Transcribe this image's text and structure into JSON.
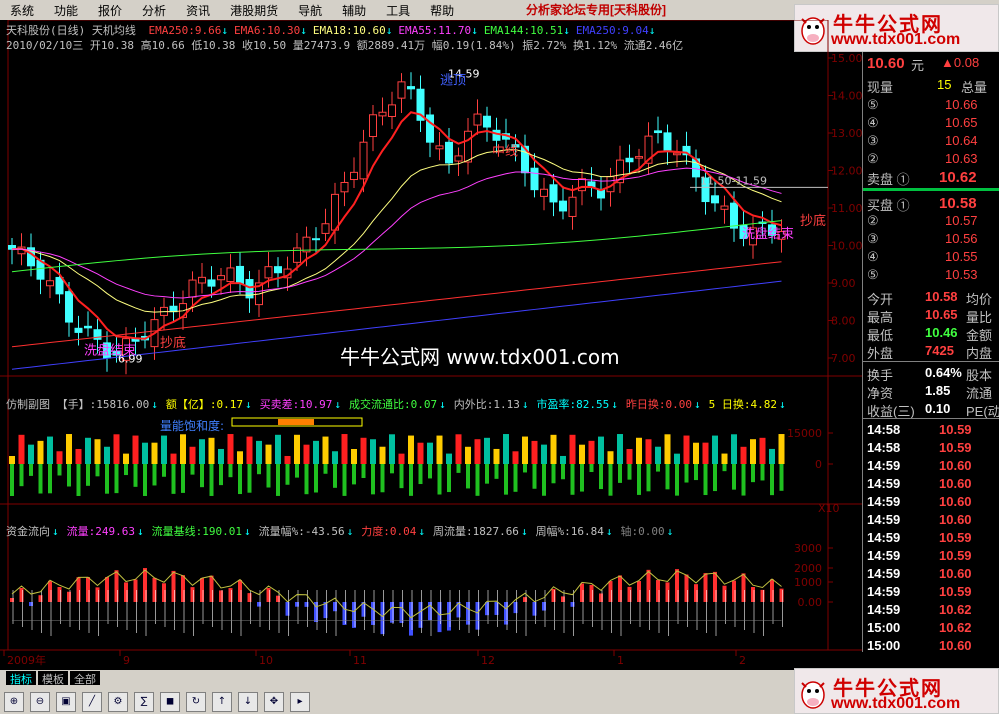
{
  "menu": {
    "items": [
      "系统",
      "功能",
      "报价",
      "分析",
      "资讯",
      "港股期货",
      "导航",
      "辅助",
      "工具",
      "帮助"
    ],
    "forum": "分析家论坛专用",
    "stock_tag": "[天科股份]"
  },
  "logo": {
    "title": "牛牛公式网",
    "url": "www.tdx001.com"
  },
  "chart": {
    "title": "天科股份(日线) 天机均线",
    "ema_labels": [
      {
        "text": "EMA250:9.66",
        "color": "#ff4040"
      },
      {
        "text": "EMA6:10.30",
        "color": "#ff4040"
      },
      {
        "text": "EMA18:10.60",
        "color": "#ffff80"
      },
      {
        "text": "EMA55:11.70",
        "color": "#ff40ff"
      },
      {
        "text": "EMA144:10.51",
        "color": "#40ff40"
      },
      {
        "text": "EMA250:9.04",
        "color": "#4040ff"
      }
    ],
    "ohlc_line": "2010/02/10三 开10.38 高10.66 低10.38 收10.50 量27473.9 额2889.41万 幅0.19(1.84%) 振2.72% 换1.12% 流通2.46亿",
    "y_ticks": [
      "15.00",
      "14.00",
      "13.00",
      "12.00",
      "11.00",
      "10.00",
      "9.00",
      "8.00",
      "7.00"
    ],
    "annotations": {
      "high": "14.59",
      "low": "6.99",
      "level": "11.50-11.59",
      "wash_end1": "洗盘结束",
      "buy_bottom1": "抄底",
      "wash_end2": "洗盘结束",
      "buy_bottom2": "抄底",
      "mid_line": "中线",
      "top_label": "逃顶"
    },
    "watermark": "牛牛公式网 www.tdx001.com"
  },
  "sub1": {
    "header_items": [
      {
        "text": "仿制副图 【手】:15816.00",
        "color": "#c0c0c0"
      },
      {
        "text": "额【亿】:0.17",
        "color": "#ffff00"
      },
      {
        "text": "买卖差:10.97",
        "color": "#ff40ff"
      },
      {
        "text": "成交流通比:0.07",
        "color": "#40ff40"
      },
      {
        "text": "内外比:1.13",
        "color": "#c0c0c0"
      },
      {
        "text": "市盈率:82.55",
        "color": "#00ffff"
      },
      {
        "text": "昨日换:0.00",
        "color": "#ff4040"
      },
      {
        "text": "5 日换:4.82",
        "color": "#ffff00"
      }
    ],
    "saturation_label": "量能饱和度:",
    "y_ticks": [
      "15000",
      "0"
    ],
    "multiplier": "X10"
  },
  "sub2": {
    "header_items": [
      {
        "text": "资金流向",
        "color": "#c0c0c0"
      },
      {
        "text": "流量:249.63",
        "color": "#ff40ff"
      },
      {
        "text": "流量基线:190.01",
        "color": "#40ff40"
      },
      {
        "text": "流量幅%:-43.56",
        "color": "#c0c0c0"
      },
      {
        "text": "力度:0.04",
        "color": "#ff4040"
      },
      {
        "text": "周流量:1827.66",
        "color": "#c0c0c0"
      },
      {
        "text": "周幅%:16.84",
        "color": "#c0c0c0"
      },
      {
        "text": "轴:0.00",
        "color": "#808080"
      }
    ],
    "y_ticks": [
      "3000",
      "2000",
      "1000",
      "0.00"
    ]
  },
  "x_axis": {
    "labels": [
      "2009年",
      "9",
      "10",
      "11",
      "12",
      "1",
      "2"
    ]
  },
  "quote": {
    "price": "10.60",
    "unit": "元",
    "change": "▲0.08",
    "volume_label": "现量",
    "volume": "15",
    "total_label": "总量",
    "asks": [
      {
        "label": "⑤",
        "price": "10.66"
      },
      {
        "label": "④",
        "price": "10.65"
      },
      {
        "label": "③",
        "price": "10.64"
      },
      {
        "label": "②",
        "price": "10.63"
      },
      {
        "label": "卖盘 ①",
        "price": "10.62"
      }
    ],
    "bids": [
      {
        "label": "买盘 ①",
        "price": "10.58"
      },
      {
        "label": "②",
        "price": "10.57"
      },
      {
        "label": "③",
        "price": "10.56"
      },
      {
        "label": "④",
        "price": "10.55"
      },
      {
        "label": "⑤",
        "price": "10.53"
      }
    ],
    "stats": [
      {
        "label": "今开",
        "value": "10.58",
        "extra": "均价"
      },
      {
        "label": "最高",
        "value": "10.65",
        "extra": "量比"
      },
      {
        "label": "最低",
        "value": "10.46",
        "extra": "金额"
      },
      {
        "label": "外盘",
        "value": "7425",
        "extra": "内盘"
      }
    ],
    "fundamentals": [
      {
        "label": "换手",
        "value": "0.64%",
        "extra": "股本"
      },
      {
        "label": "净资",
        "value": "1.85",
        "extra": "流通"
      },
      {
        "label": "收益(三)",
        "value": "0.10",
        "extra": "PE(动"
      }
    ],
    "ticks": [
      {
        "time": "14:58",
        "price": "10.59"
      },
      {
        "time": "14:58",
        "price": "10.59"
      },
      {
        "time": "14:59",
        "price": "10.60"
      },
      {
        "time": "14:59",
        "price": "10.60"
      },
      {
        "time": "14:59",
        "price": "10.60"
      },
      {
        "time": "14:59",
        "price": "10.60"
      },
      {
        "time": "14:59",
        "price": "10.59"
      },
      {
        "time": "14:59",
        "price": "10.59"
      },
      {
        "time": "14:59",
        "price": "10.60"
      },
      {
        "time": "14:59",
        "price": "10.59"
      },
      {
        "time": "14:59",
        "price": "10.62"
      },
      {
        "time": "15:00",
        "price": "10.62"
      },
      {
        "time": "15:00",
        "price": "10.60"
      }
    ]
  },
  "bottom": {
    "tabs": [
      "指标",
      "模板",
      "全部"
    ],
    "tools": [
      "放大",
      "缩小",
      "复权",
      "画线",
      "系统",
      "计算",
      "保存",
      "刷新",
      "向上",
      "向下",
      "平移",
      "选择"
    ]
  }
}
